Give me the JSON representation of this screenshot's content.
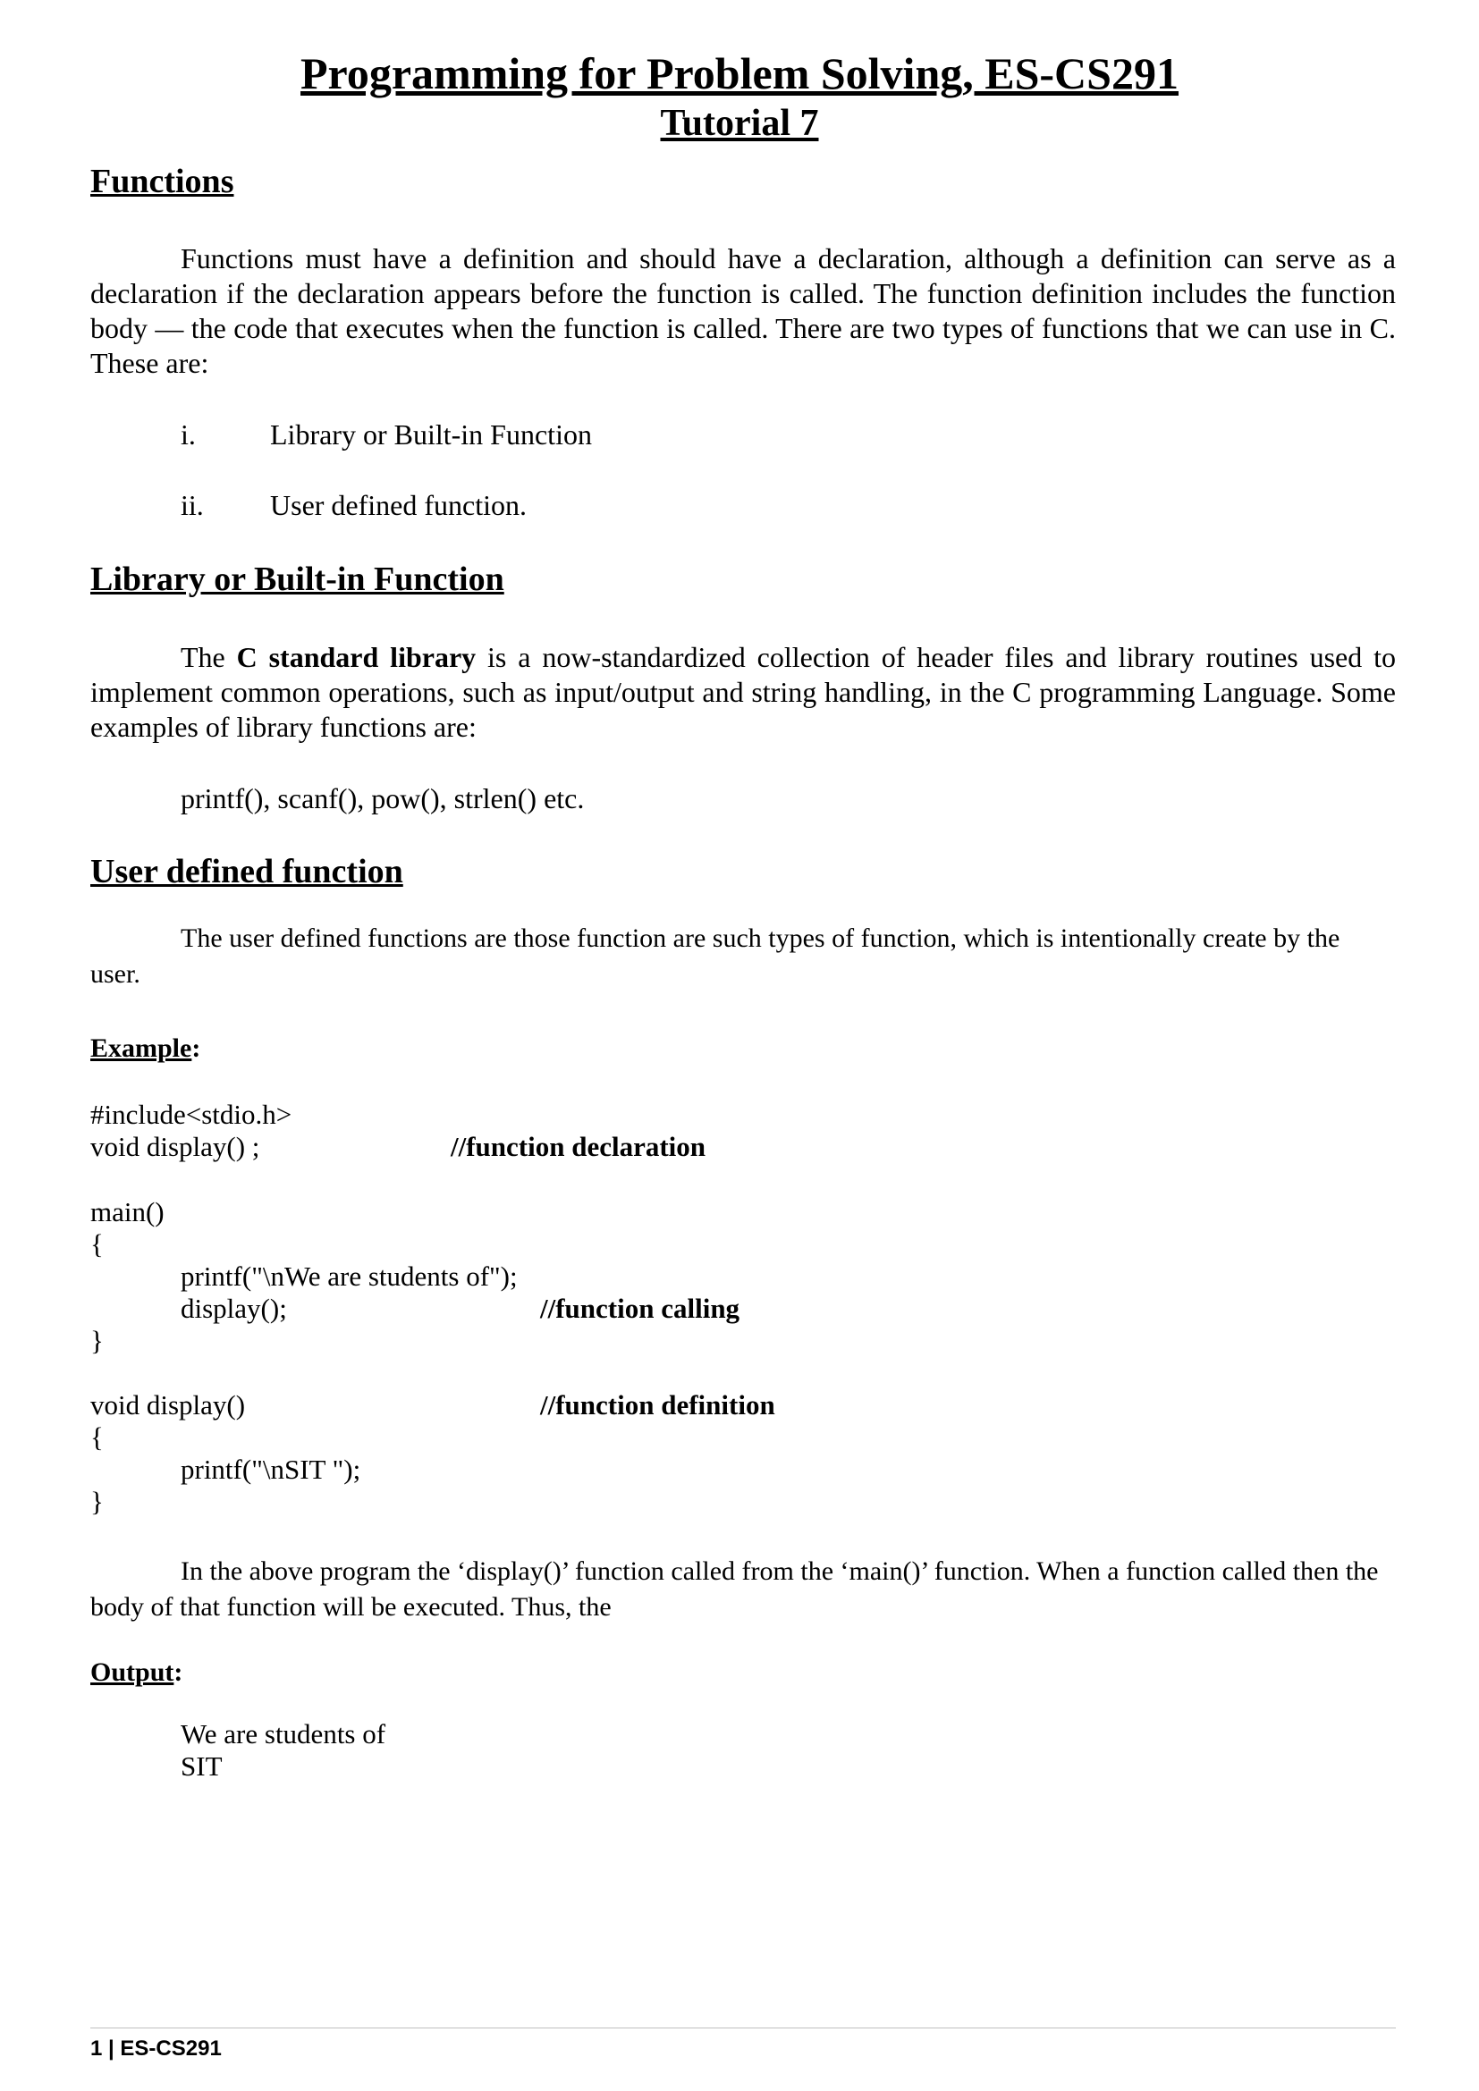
{
  "header": {
    "title": "Programming for Problem Solving, ES-CS291",
    "subtitle": "Tutorial 7"
  },
  "sections": {
    "functions": {
      "heading": "Functions",
      "paragraph": "Functions must have a definition and should have a declaration, although a definition can serve as a declaration if the declaration appears before the function is called. The function definition includes the function body — the code that executes when the function is called. There are two types of functions that we can use in C. These are:",
      "list": [
        {
          "num": "i.",
          "text": "Library or Built-in Function"
        },
        {
          "num": "ii.",
          "text": "User defined function."
        }
      ]
    },
    "library": {
      "heading": "Library or Built-in Function",
      "para_start": "The ",
      "para_bold": "C standard library",
      "para_rest": " is a now-standardized collection of header files and library routines used to implement common operations, such as input/output and string handling, in the C programming Language. Some examples of library functions are:",
      "examples": "printf(), scanf(), pow(), strlen() etc."
    },
    "user_defined": {
      "heading": "User defined function",
      "paragraph": "The user defined functions are those function are such types of function, which is intentionally create by the user."
    }
  },
  "example": {
    "label": "Example",
    "colon": ":",
    "code": {
      "include": "#include<stdio.h>",
      "decl": "void display() ;",
      "decl_comment": "//function declaration",
      "main": "main()",
      "open1": "{",
      "printf1": "printf(\"\\nWe are students of\");",
      "call": "display();",
      "call_comment": "//function calling",
      "close1": "}",
      "def": "void display()",
      "def_comment": "//function definition",
      "open2": "{",
      "printf2": "printf(\"\\nSIT \");",
      "close2": "}"
    },
    "explanation": "In the above program the ‘display()’ function called from the ‘main()’ function. When a function called then the body of that function will be executed. Thus, the"
  },
  "output": {
    "label": "Output",
    "colon": ":",
    "lines": [
      "We are students of",
      "SIT"
    ]
  },
  "footer": {
    "text": "1 | ES-CS291"
  }
}
